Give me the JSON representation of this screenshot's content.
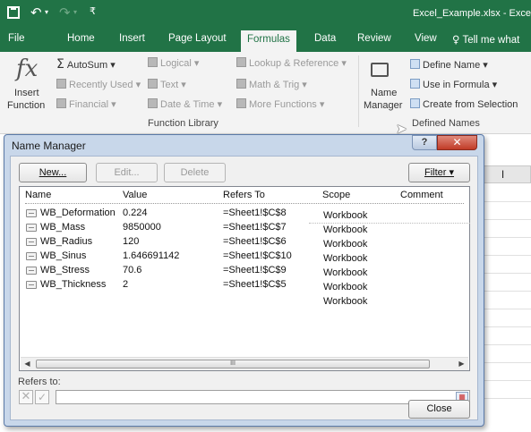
{
  "titlebar": {
    "customize_glyph": "₹",
    "filename": "Excel_Example.xlsx - Exce"
  },
  "tabs": [
    {
      "label": "File"
    },
    {
      "label": "Home"
    },
    {
      "label": "Insert"
    },
    {
      "label": "Page Layout"
    },
    {
      "label": "Formulas",
      "active": true
    },
    {
      "label": "Data"
    },
    {
      "label": "Review"
    },
    {
      "label": "View"
    },
    {
      "label": "Tell me what"
    }
  ],
  "ribbon": {
    "insert_function": {
      "line1": "Insert",
      "line2": "Function"
    },
    "autosum": "AutoSum",
    "recently_used": "Recently Used",
    "financial": "Financial",
    "logical": "Logical",
    "text": "Text",
    "date_time": "Date & Time",
    "lookup_reference": "Lookup & Reference",
    "math_trig": "Math & Trig",
    "more_functions": "More Functions",
    "function_library_label": "Function Library",
    "name_manager": {
      "line1": "Name",
      "line2": "Manager"
    },
    "define_name": "Define Name",
    "use_in_formula": "Use in Formula",
    "create_from_selection": "Create from Selection",
    "defined_names_label": "Defined Names"
  },
  "sheet": {
    "column_header": "I"
  },
  "dialog": {
    "title": "Name Manager",
    "help_label": "?",
    "close_label": "✕",
    "new_button": "New...",
    "edit_button": "Edit...",
    "delete_button": "Delete",
    "filter_button": "Filter ▾",
    "columns": {
      "name": "Name",
      "value": "Value",
      "refers_to": "Refers To",
      "scope": "Scope",
      "comment": "Comment"
    },
    "rows": [
      {
        "name": "WB_Deformation",
        "value": "0.224",
        "refers_to": "=Sheet1!$C$8"
      },
      {
        "name": "WB_Mass",
        "value": "9850000",
        "refers_to": "=Sheet1!$C$7"
      },
      {
        "name": "WB_Radius",
        "value": "120",
        "refers_to": "=Sheet1!$C$6"
      },
      {
        "name": "WB_Sinus",
        "value": "1.646691142",
        "refers_to": "=Sheet1!$C$10"
      },
      {
        "name": "WB_Stress",
        "value": "70.6",
        "refers_to": "=Sheet1!$C$9"
      },
      {
        "name": "WB_Thickness",
        "value": "2",
        "refers_to": "=Sheet1!$C$5"
      }
    ],
    "scopes": [
      "Workbook",
      "Workbook",
      "Workbook",
      "Workbook",
      "Workbook",
      "Workbook",
      "Workbook"
    ],
    "scroll_thumb_glyph": "III",
    "refers_to_label": "Refers to:",
    "refers_to_value": "",
    "close_button": "Close"
  },
  "colors": {
    "excel_green": "#217346",
    "dialog_frame": "#c8d7ea",
    "close_red": "#c13b27"
  },
  "icons": [
    "save-icon",
    "undo-icon",
    "redo-icon",
    "fx-icon",
    "autosum-icon",
    "name-manager-icon",
    "define-name-icon",
    "use-in-formula-icon",
    "create-from-selection-icon",
    "name-entry-icon",
    "cancel-icon",
    "enter-icon",
    "collapse-dialog-icon",
    "mouse-cursor-icon"
  ]
}
